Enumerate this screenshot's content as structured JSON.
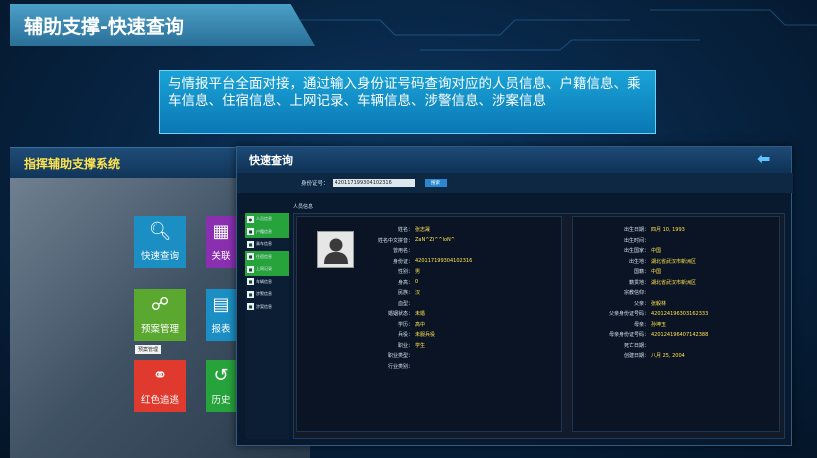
{
  "slide": {
    "title": "辅助支撑-快速查询",
    "description": "与情报平台全面对接，通过输入身份证号码查询对应的人员信息、户籍信息、乘车信息、住宿信息、上网记录、车辆信息、涉警信息、涉案信息"
  },
  "system": {
    "title": "指挥辅助支撑系统",
    "tiles": [
      {
        "label": "快速查询",
        "icon": "search-icon",
        "color": "#1b8fc4"
      },
      {
        "label": "关联",
        "icon": "relation-icon",
        "color": "#8a2fb0"
      },
      {
        "label": "预案管理",
        "icon": "plan-icon",
        "color": "#5aa82f"
      },
      {
        "label": "报表",
        "icon": "report-icon",
        "color": "#1b8fc4"
      },
      {
        "label": "红色追逃",
        "icon": "handcuff-icon",
        "color": "#e03a2e"
      },
      {
        "label": "历史",
        "icon": "history-icon",
        "color": "#27a33b"
      }
    ],
    "tooltip": "预案管理"
  },
  "query": {
    "title": "快速查询",
    "search_label": "身份证号：",
    "id_value": "420117199304102316",
    "search_button": "搜索",
    "section_label": "人员信息",
    "nav_items": [
      {
        "label": "人员信息",
        "active": true
      },
      {
        "label": "户籍信息",
        "active": true
      },
      {
        "label": "乘车信息",
        "active": false
      },
      {
        "label": "住宿信息",
        "active": true
      },
      {
        "label": "上网记录",
        "active": true
      },
      {
        "label": "车辆信息",
        "active": false
      },
      {
        "label": "涉警信息",
        "active": false
      },
      {
        "label": "涉案信息",
        "active": false
      }
    ],
    "left_fields": [
      {
        "label": "姓名：",
        "value": "张志晟"
      },
      {
        "label": "姓名中文拼音：",
        "value": "ZaN^Zi^^loN^"
      },
      {
        "label": "曾用名：",
        "value": ""
      },
      {
        "label": "身份证：",
        "value": "420117199304102316"
      },
      {
        "label": "性别：",
        "value": "男"
      },
      {
        "label": "身高：",
        "value": "0"
      },
      {
        "label": "民族：",
        "value": "汉"
      },
      {
        "label": "血型：",
        "value": ""
      },
      {
        "label": "婚姻状态：",
        "value": "未婚"
      },
      {
        "label": "学历：",
        "value": "高中"
      },
      {
        "label": "兵役：",
        "value": "未服兵役"
      },
      {
        "label": "职业：",
        "value": "学生"
      },
      {
        "label": "职业类型：",
        "value": ""
      },
      {
        "label": "行业类别：",
        "value": ""
      }
    ],
    "right_fields": [
      {
        "label": "出生日期：",
        "value": "四月 10, 1993"
      },
      {
        "label": "出生时间：",
        "value": ""
      },
      {
        "label": "出生国家：",
        "value": "中国"
      },
      {
        "label": "出生地：",
        "value": "湖北省武汉市新洲区"
      },
      {
        "label": "国籍：",
        "value": "中国"
      },
      {
        "label": "籍贯地：",
        "value": "湖北省武汉市新洲区"
      },
      {
        "label": "宗教信仰：",
        "value": ""
      },
      {
        "label": "父亲：",
        "value": "张毅林"
      },
      {
        "label": "父亲身份证号码：",
        "value": "420124196303162333"
      },
      {
        "label": "母亲：",
        "value": "孙坤玉"
      },
      {
        "label": "母亲身份证号码：",
        "value": "420124196407142388"
      },
      {
        "label": "死亡日期：",
        "value": ""
      },
      {
        "label": "创建日期：",
        "value": "八月 25, 2004"
      }
    ]
  }
}
